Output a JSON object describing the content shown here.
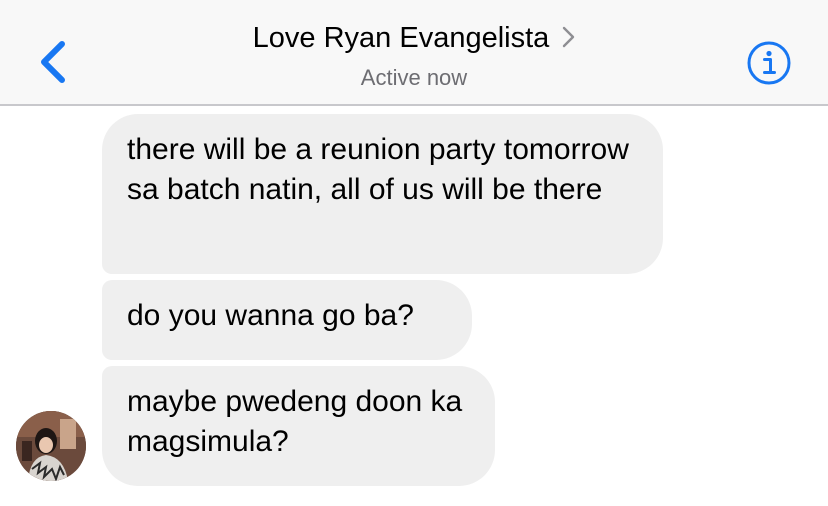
{
  "header": {
    "contact_name": "Love Ryan Evangelista",
    "status": "Active now",
    "back_icon": "chevron-left-icon",
    "info_icon": "info-circle-icon",
    "accent_color": "#1877f2"
  },
  "messages": [
    {
      "sender": "Love Ryan Evangelista",
      "text": "there will be a reunion party tomorrow sa batch natin, all of us will be there"
    },
    {
      "sender": "Love Ryan Evangelista",
      "text": "do you wanna go ba?"
    },
    {
      "sender": "Love Ryan Evangelista",
      "text": "maybe pwedeng doon ka magsimula?"
    }
  ],
  "colors": {
    "header_bg": "#f8f8f8",
    "bubble_bg": "#efefef",
    "subtitle": "#6d6d72"
  }
}
